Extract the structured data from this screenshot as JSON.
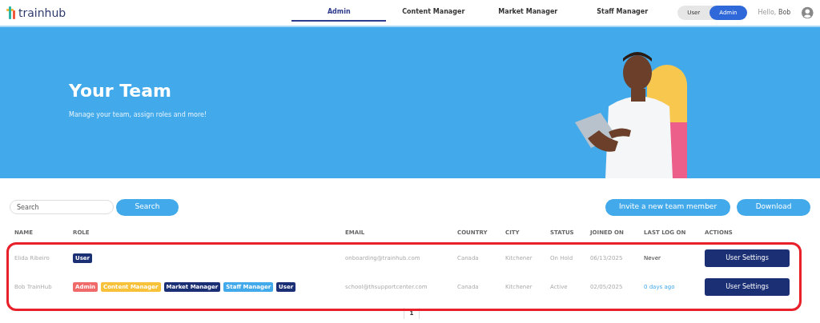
{
  "brand": {
    "name": "trainhub"
  },
  "nav": {
    "tabs": [
      {
        "label": "Admin",
        "selected": true
      },
      {
        "label": "Content Manager",
        "selected": false
      },
      {
        "label": "Market Manager",
        "selected": false
      },
      {
        "label": "Staff Manager",
        "selected": false
      }
    ],
    "mode_toggle": [
      {
        "label": "User",
        "selected": false
      },
      {
        "label": "Admin",
        "selected": true
      }
    ],
    "greeting": "Hello,",
    "user_name": "Bob"
  },
  "hero": {
    "title": "Your Team",
    "subtitle": "Manage your team, assign roles and more!"
  },
  "search": {
    "placeholder": "Search",
    "button": "Search"
  },
  "actions": [
    "Invite a new team member",
    "Download"
  ],
  "table": {
    "columns": [
      "NAME",
      "ROLE",
      "EMAIL",
      "COUNTRY",
      "CITY",
      "STATUS",
      "JOINED ON",
      "LAST LOG ON",
      "ACTIONS"
    ],
    "rows": [
      {
        "name": "Elida Ribeiro",
        "roles": [
          {
            "label": "User",
            "color": "#1b2f74"
          }
        ],
        "email": "onboarding@trainhub.com",
        "country": "Canada",
        "city": "Kitchener",
        "status": "On Hold",
        "joined_on": "06/13/2025",
        "last_log_on": {
          "text": "Never",
          "kind": "plain"
        },
        "action": "User Settings"
      },
      {
        "name": "Bob TrainHub",
        "roles": [
          {
            "label": "Admin",
            "color": "#f06a6a"
          },
          {
            "label": "Content Manager",
            "color": "#f8c13a"
          },
          {
            "label": "Market Manager",
            "color": "#1b2f74"
          },
          {
            "label": "Staff Manager",
            "color": "#42a9ea"
          },
          {
            "label": "User",
            "color": "#1b2f74"
          }
        ],
        "email": "school@thsupportcenter.com",
        "country": "Canada",
        "city": "Kitchener",
        "status": "Active",
        "joined_on": "02/05/2025",
        "last_log_on": {
          "text": "0 days ago",
          "kind": "recent"
        },
        "action": "User Settings"
      }
    ]
  },
  "pagination": [
    {
      "label": "1",
      "selected": true
    }
  ]
}
